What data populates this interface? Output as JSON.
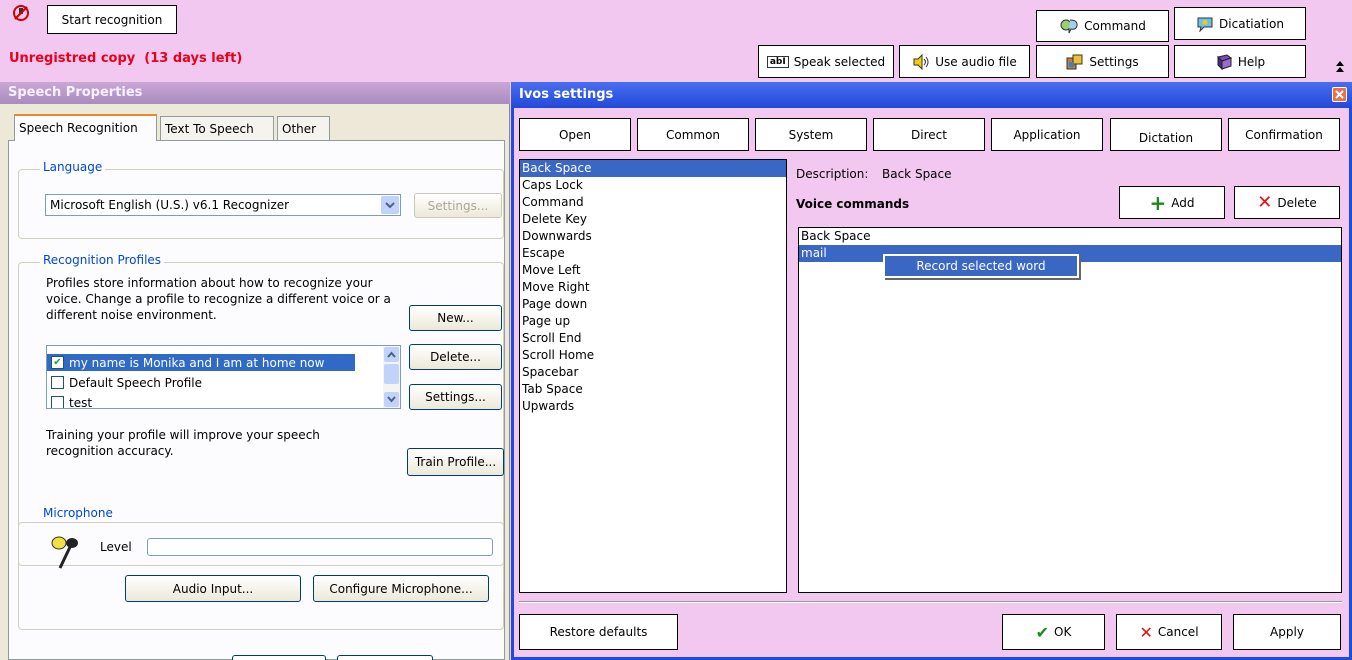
{
  "toolbar": {
    "start_recognition": "Start recognition",
    "unregistered_notice": "Unregistred copy  (13 days left)",
    "speak_selected": "Speak selected",
    "use_audio_file": "Use audio file",
    "command": "Command",
    "dictation": "Dicatiation",
    "settings": "Settings",
    "help": "Help",
    "speak_icon_text": "abI"
  },
  "speech_properties": {
    "title": "Speech Properties",
    "tabs": [
      "Speech Recognition",
      "Text To Speech",
      "Other"
    ],
    "language": {
      "group_label": "Language",
      "recognizer": "Microsoft English (U.S.) v6.1 Recognizer",
      "settings_button": "Settings..."
    },
    "profiles": {
      "group_label": "Recognition Profiles",
      "description": "Profiles store information about how to recognize your voice.  Change a profile to recognize a different voice or a different noise environment.",
      "new_button": "New...",
      "delete_button": "Delete...",
      "settings_button": "Settings...",
      "items": [
        {
          "label": "my name is Monika and I am at home now",
          "checked": true
        },
        {
          "label": "Default Speech Profile",
          "checked": false
        },
        {
          "label": "test",
          "checked": false
        }
      ],
      "training_text": "Training your profile will improve your speech recognition accuracy.",
      "train_button": "Train Profile..."
    },
    "microphone": {
      "group_label": "Microphone",
      "level_label": "Level",
      "level": 0,
      "audio_input_button": "Audio Input...",
      "configure_button": "Configure Microphone..."
    }
  },
  "ivos": {
    "title": "Ivos settings",
    "categories": [
      "Open",
      "Common",
      "System",
      "Direct",
      "Application",
      "Dictation",
      "Confirmation"
    ],
    "commands": [
      "Back Space",
      "Caps Lock",
      "Command",
      "Delete Key",
      "Downwards",
      "Escape",
      "Move Left",
      "Move Right",
      "Page down",
      "Page up",
      "Scroll End",
      "Scroll Home",
      "Spacebar",
      "Tab Space",
      "Upwards"
    ],
    "selected_command": "Back Space",
    "description_label": "Description:",
    "description_value": "Back Space",
    "voice_commands_label": "Voice commands",
    "add_button": "Add",
    "delete_button": "Delete",
    "voice_commands": [
      "Back Space",
      "mail"
    ],
    "selected_voice_command": "mail",
    "context_menu_item": "Record selected word",
    "restore_defaults": "Restore defaults",
    "ok": "OK",
    "cancel": "Cancel",
    "apply": "Apply"
  },
  "colors": {
    "background_pink": "#f3c8f0",
    "ivos_title_blue": "#2149d9",
    "selection_blue": "#3a66c4",
    "warning_red": "#e8001c"
  }
}
